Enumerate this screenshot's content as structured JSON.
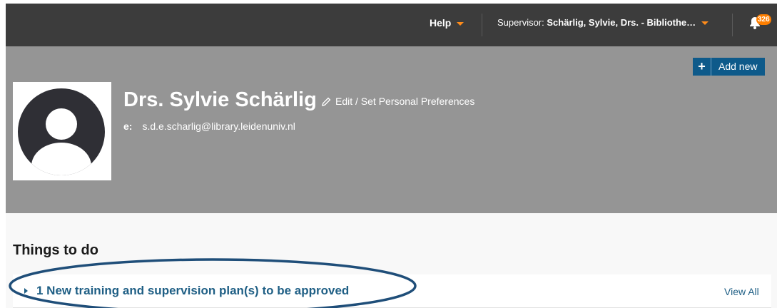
{
  "topbar": {
    "help_label": "Help",
    "supervisor_prefix": "Supervisor: ",
    "supervisor_name": "Schärlig, Sylvie, Drs. - Bibliothe…",
    "notification_count": "326",
    "colors": {
      "background": "#3c3c3c",
      "accent": "#ff8c1a"
    },
    "icons": [
      "caret-down-icon",
      "bell-icon"
    ]
  },
  "header": {
    "add_new_label": "Add new",
    "add_new_icon": "plus-icon",
    "name": "Drs. Sylvie Schärlig",
    "edit_label": "Edit / Set Personal Preferences",
    "edit_icon": "pencil-icon",
    "email_label": "e:",
    "email": "s.d.e.scharlig@library.leidenuniv.nl",
    "avatar_icon": "user-avatar-icon",
    "colors": {
      "background": "#959595",
      "button": "#0e5a8a"
    }
  },
  "todo": {
    "title": "Things to do",
    "items": [
      {
        "text": "1 New training and supervision plan(s) to be approved",
        "action": "View All"
      }
    ],
    "colors": {
      "link": "#1f5f85",
      "highlight_ellipse": "#1f4e79"
    }
  }
}
